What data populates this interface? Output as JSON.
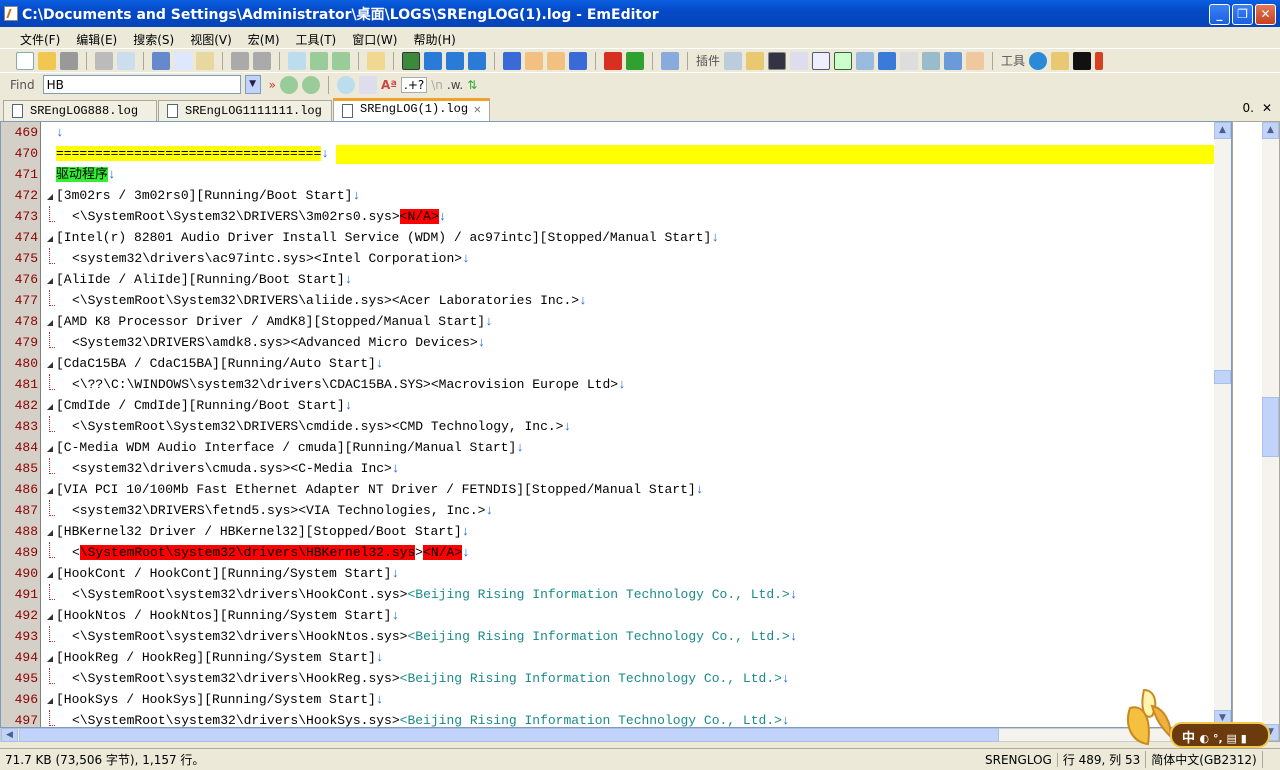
{
  "window": {
    "title": "C:\\Documents and Settings\\Administrator\\桌面\\LOGS\\SREngLOG(1).log - EmEditor"
  },
  "menu": [
    "文件(F)",
    "编辑(E)",
    "搜索(S)",
    "视图(V)",
    "宏(M)",
    "工具(T)",
    "窗口(W)",
    "帮助(H)"
  ],
  "toolbar": {
    "plugins_label": "插件",
    "tools_label": "工具"
  },
  "find": {
    "label": "Find",
    "value": "HB",
    "regex_label": ".+?",
    "newline_label": "\\n",
    "word_label": ".w."
  },
  "tabs": [
    {
      "label": "SREngLOG888.log"
    },
    {
      "label": "SREngLOG1111111.log"
    },
    {
      "label": "SREngLOG(1).log",
      "active": true
    }
  ],
  "tabbar_right": "0.",
  "lines": [
    {
      "n": "469",
      "f": "",
      "segs": []
    },
    {
      "n": "470",
      "f": "",
      "full": "yellow",
      "segs": [
        {
          "t": "==================================",
          "s": "yel"
        }
      ]
    },
    {
      "n": "471",
      "f": "",
      "segs": [
        {
          "t": "驱动程序",
          "s": "grn"
        }
      ]
    },
    {
      "n": "472",
      "f": "open",
      "segs": [
        {
          "t": "[3m02rs / 3m02rs0][Running/Boot Start]"
        }
      ]
    },
    {
      "n": "473",
      "f": "child",
      "segs": [
        {
          "t": "<\\SystemRoot\\System32\\DRIVERS\\3m02rs0.sys>"
        },
        {
          "t": "<N/A>",
          "s": "red"
        }
      ]
    },
    {
      "n": "474",
      "f": "open",
      "segs": [
        {
          "t": "[Intel(r) 82801 Audio Driver Install Service (WDM) / ac97intc][Stopped/Manual Start]"
        }
      ]
    },
    {
      "n": "475",
      "f": "child",
      "segs": [
        {
          "t": "<system32\\drivers\\ac97intc.sys><Intel Corporation>"
        }
      ]
    },
    {
      "n": "476",
      "f": "open",
      "segs": [
        {
          "t": "[AliIde / AliIde][Running/Boot Start]"
        }
      ]
    },
    {
      "n": "477",
      "f": "child",
      "segs": [
        {
          "t": "<\\SystemRoot\\System32\\DRIVERS\\aliide.sys><Acer Laboratories Inc.>"
        }
      ]
    },
    {
      "n": "478",
      "f": "open",
      "segs": [
        {
          "t": "[AMD K8 Processor Driver / AmdK8][Stopped/Manual Start]"
        }
      ]
    },
    {
      "n": "479",
      "f": "child",
      "segs": [
        {
          "t": "<System32\\DRIVERS\\amdk8.sys><Advanced Micro Devices>"
        }
      ]
    },
    {
      "n": "480",
      "f": "open",
      "segs": [
        {
          "t": "[CdaC15BA / CdaC15BA][Running/Auto Start]"
        }
      ]
    },
    {
      "n": "481",
      "f": "child",
      "segs": [
        {
          "t": "<\\??\\C:\\WINDOWS\\system32\\drivers\\CDAC15BA.SYS><Macrovision Europe Ltd>"
        }
      ]
    },
    {
      "n": "482",
      "f": "open",
      "segs": [
        {
          "t": "[CmdIde / CmdIde][Running/Boot Start]"
        }
      ]
    },
    {
      "n": "483",
      "f": "child",
      "segs": [
        {
          "t": "<\\SystemRoot\\System32\\DRIVERS\\cmdide.sys><CMD Technology, Inc.>"
        }
      ]
    },
    {
      "n": "484",
      "f": "open",
      "segs": [
        {
          "t": "[C-Media WDM Audio Interface / cmuda][Running/Manual Start]"
        }
      ]
    },
    {
      "n": "485",
      "f": "child",
      "segs": [
        {
          "t": "<system32\\drivers\\cmuda.sys><C-Media Inc>"
        }
      ]
    },
    {
      "n": "486",
      "f": "open",
      "segs": [
        {
          "t": "[VIA PCI 10/100Mb Fast Ethernet Adapter NT Driver / FETNDIS][Stopped/Manual Start]"
        }
      ]
    },
    {
      "n": "487",
      "f": "child",
      "segs": [
        {
          "t": "<system32\\DRIVERS\\fetnd5.sys><VIA Technologies, Inc.>"
        }
      ]
    },
    {
      "n": "488",
      "f": "open",
      "segs": [
        {
          "t": "[HBKernel32 Driver / HBKernel32][Stopped/Boot Start]"
        }
      ]
    },
    {
      "n": "489",
      "f": "child",
      "segs": [
        {
          "t": "<"
        },
        {
          "t": "\\SystemRoot\\system32\\drivers\\HBKernel32.sys",
          "s": "red"
        },
        {
          "t": ">"
        },
        {
          "t": "<N/A>",
          "s": "red"
        }
      ]
    },
    {
      "n": "490",
      "f": "open",
      "segs": [
        {
          "t": "[HookCont / HookCont][Running/System Start]"
        }
      ]
    },
    {
      "n": "491",
      "f": "child",
      "segs": [
        {
          "t": "<\\SystemRoot\\system32\\drivers\\HookCont.sys>"
        },
        {
          "t": "<Beijing Rising Information Technology Co., Ltd.>",
          "s": "teal"
        }
      ]
    },
    {
      "n": "492",
      "f": "open",
      "segs": [
        {
          "t": "[HookNtos / HookNtos][Running/System Start]"
        }
      ]
    },
    {
      "n": "493",
      "f": "child",
      "segs": [
        {
          "t": "<\\SystemRoot\\system32\\drivers\\HookNtos.sys>"
        },
        {
          "t": "<Beijing Rising Information Technology Co., Ltd.>",
          "s": "teal"
        }
      ]
    },
    {
      "n": "494",
      "f": "open",
      "segs": [
        {
          "t": "[HookReg / HookReg][Running/System Start]"
        }
      ]
    },
    {
      "n": "495",
      "f": "child",
      "segs": [
        {
          "t": "<\\SystemRoot\\system32\\drivers\\HookReg.sys>"
        },
        {
          "t": "<Beijing Rising Information Technology Co., Ltd.>",
          "s": "teal"
        }
      ]
    },
    {
      "n": "496",
      "f": "open",
      "segs": [
        {
          "t": "[HookSys / HookSys][Running/System Start]"
        }
      ]
    },
    {
      "n": "497",
      "f": "child",
      "segs": [
        {
          "t": "<\\SystemRoot\\system32\\drivers\\HookSys.sys>"
        },
        {
          "t": "<Beijing Rising Information Technology Co., Ltd.>",
          "s": "teal"
        }
      ]
    }
  ],
  "eol_marker": "↓",
  "status": {
    "size": "71.7 KB (73,506 字节), 1,157 行。",
    "mode": "SRENGLOG",
    "position": "行 489, 列 53",
    "encoding": "简体中文(GB2312)"
  },
  "ime": {
    "label": "中"
  }
}
